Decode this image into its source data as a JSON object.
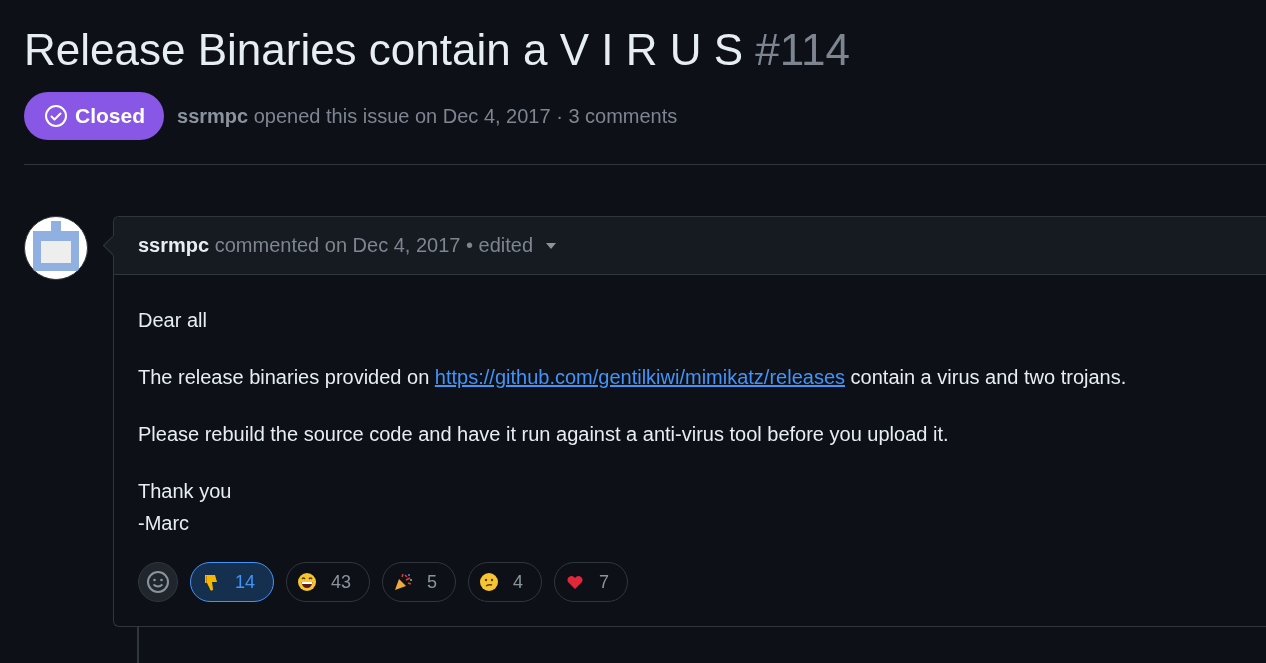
{
  "issue": {
    "title": "Release Binaries contain a V I R U S",
    "number": "#114",
    "closed": true,
    "state_label": "Closed",
    "author": "ssrmpc",
    "meta": "opened this issue on Dec 4, 2017 · 3 comments"
  },
  "comment": {
    "author": "ssrmpc",
    "meta": "commented on Dec 4, 2017 • edited",
    "paragraphs": [
      {
        "kind": "text",
        "lines": [
          "Dear all"
        ]
      },
      {
        "kind": "link",
        "before": "The release binaries provided on",
        "link": "https://github.com/gentilkiwi/mimikatz/releases",
        "after": "contain a virus and two trojans."
      },
      {
        "kind": "text",
        "lines": [
          "Please rebuild the source code and have it run against a anti-virus tool before you upload it."
        ]
      },
      {
        "kind": "text",
        "lines": [
          "Thank you",
          "-Marc"
        ]
      }
    ],
    "reactions": [
      {
        "kind": "thumbsdown",
        "count": "14",
        "selected": true
      },
      {
        "kind": "laugh",
        "count": "43",
        "selected": false
      },
      {
        "kind": "tada",
        "count": "5",
        "selected": false
      },
      {
        "kind": "confused",
        "count": "4",
        "selected": false
      },
      {
        "kind": "heart",
        "count": "7",
        "selected": false
      }
    ]
  }
}
